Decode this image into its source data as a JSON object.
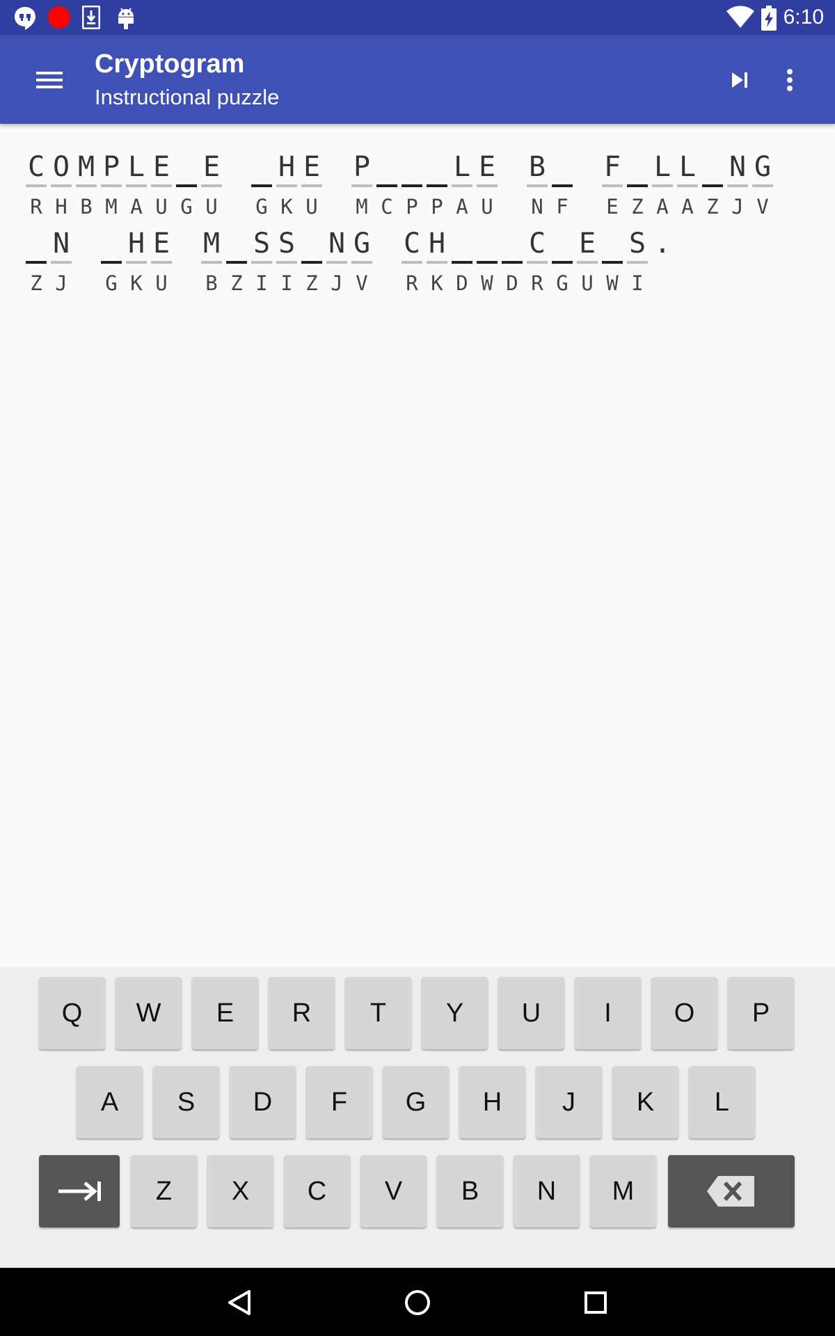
{
  "status_bar": {
    "time": "6:10",
    "icons": [
      "hangouts-icon",
      "record-icon",
      "download-icon",
      "android-icon",
      "wifi-icon",
      "battery-charging-icon"
    ]
  },
  "app_bar": {
    "title": "Cryptogram",
    "subtitle": "Instructional puzzle",
    "actions": [
      "menu-icon",
      "skip-next-icon",
      "more-vert-icon"
    ]
  },
  "puzzle": {
    "lines": [
      [
        {
          "guess": "COMPLE_E",
          "cipher": "RHBMAUGU"
        },
        {
          "guess": "_HE",
          "cipher": "GKU"
        },
        {
          "guess": "P___LE",
          "cipher": "MCPPAU"
        },
        {
          "guess": "B_",
          "cipher": "NF"
        },
        {
          "guess": "F_LL_NG",
          "cipher": "EZAAZJV"
        }
      ],
      [
        {
          "guess": "_N",
          "cipher": "ZJ"
        },
        {
          "guess": "_HE",
          "cipher": "GKU"
        },
        {
          "guess": "M_SS_NG",
          "cipher": "BZIIZJV"
        },
        {
          "guess": "CH___C_E_S.",
          "cipher": "RKDWDRGUWI"
        }
      ]
    ]
  },
  "keyboard": {
    "rows": [
      [
        "Q",
        "W",
        "E",
        "R",
        "T",
        "Y",
        "U",
        "I",
        "O",
        "P"
      ],
      [
        "A",
        "S",
        "D",
        "F",
        "G",
        "H",
        "J",
        "K",
        "L"
      ],
      [
        "Z",
        "X",
        "C",
        "V",
        "B",
        "N",
        "M"
      ]
    ],
    "special_keys": [
      "tab-icon",
      "backspace-icon"
    ]
  },
  "nav_bar": {
    "buttons": [
      "back-icon",
      "home-icon",
      "recents-icon"
    ]
  }
}
